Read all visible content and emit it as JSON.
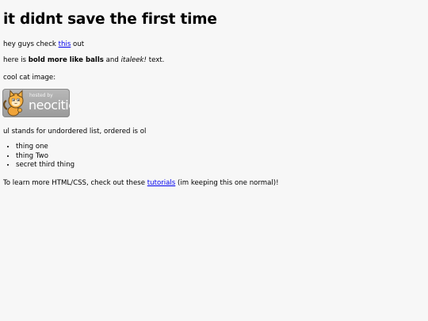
{
  "heading": "it didnt save the first time",
  "intro": {
    "before": "hey guys check ",
    "link": "this",
    "after": " out"
  },
  "formatting": {
    "before": "here is ",
    "bold": "bold more like balls",
    "middle": " and ",
    "italic": "italeek!",
    "after": " text."
  },
  "image_caption": "cool cat image:",
  "badge": {
    "hosted_by": "hosted by",
    "brand": "neocities"
  },
  "list_intro": "ul stands for undordered list, ordered is ol",
  "list_items": [
    "thing one",
    "thing Two",
    "secret third thing"
  ],
  "footer": {
    "before": "To learn more HTML/CSS, check out these ",
    "link": "tutorials",
    "after": " (im keeping this one normal)!"
  }
}
